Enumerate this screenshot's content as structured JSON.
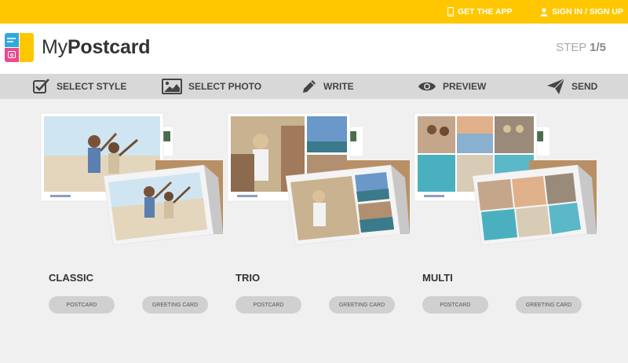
{
  "topbar": {
    "get_app": "GET THE APP",
    "sign_in": "SIGN IN / SIGN UP"
  },
  "header": {
    "logo_light": "My",
    "logo_bold": "Postcard",
    "step_label": "STEP",
    "step_value": "1/5"
  },
  "steps": [
    {
      "label": "SELECT STYLE",
      "icon": "checkbox-icon"
    },
    {
      "label": "SELECT PHOTO",
      "icon": "image-icon"
    },
    {
      "label": "WRITE",
      "icon": "pencil-icon"
    },
    {
      "label": "PREVIEW",
      "icon": "eye-icon"
    },
    {
      "label": "SEND",
      "icon": "paper-plane-icon"
    }
  ],
  "styles": [
    {
      "name": "CLASSIC",
      "postcard": "POSTCARD",
      "greeting": "GREETING CARD"
    },
    {
      "name": "TRIO",
      "postcard": "POSTCARD",
      "greeting": "GREETING CARD"
    },
    {
      "name": "MULTI",
      "postcard": "POSTCARD",
      "greeting": "GREETING CARD"
    }
  ],
  "colors": {
    "topbar": "#ffc700",
    "stepsbar": "#d8d8d8",
    "pill": "#d0d0d0",
    "kraft": "#b99066"
  }
}
